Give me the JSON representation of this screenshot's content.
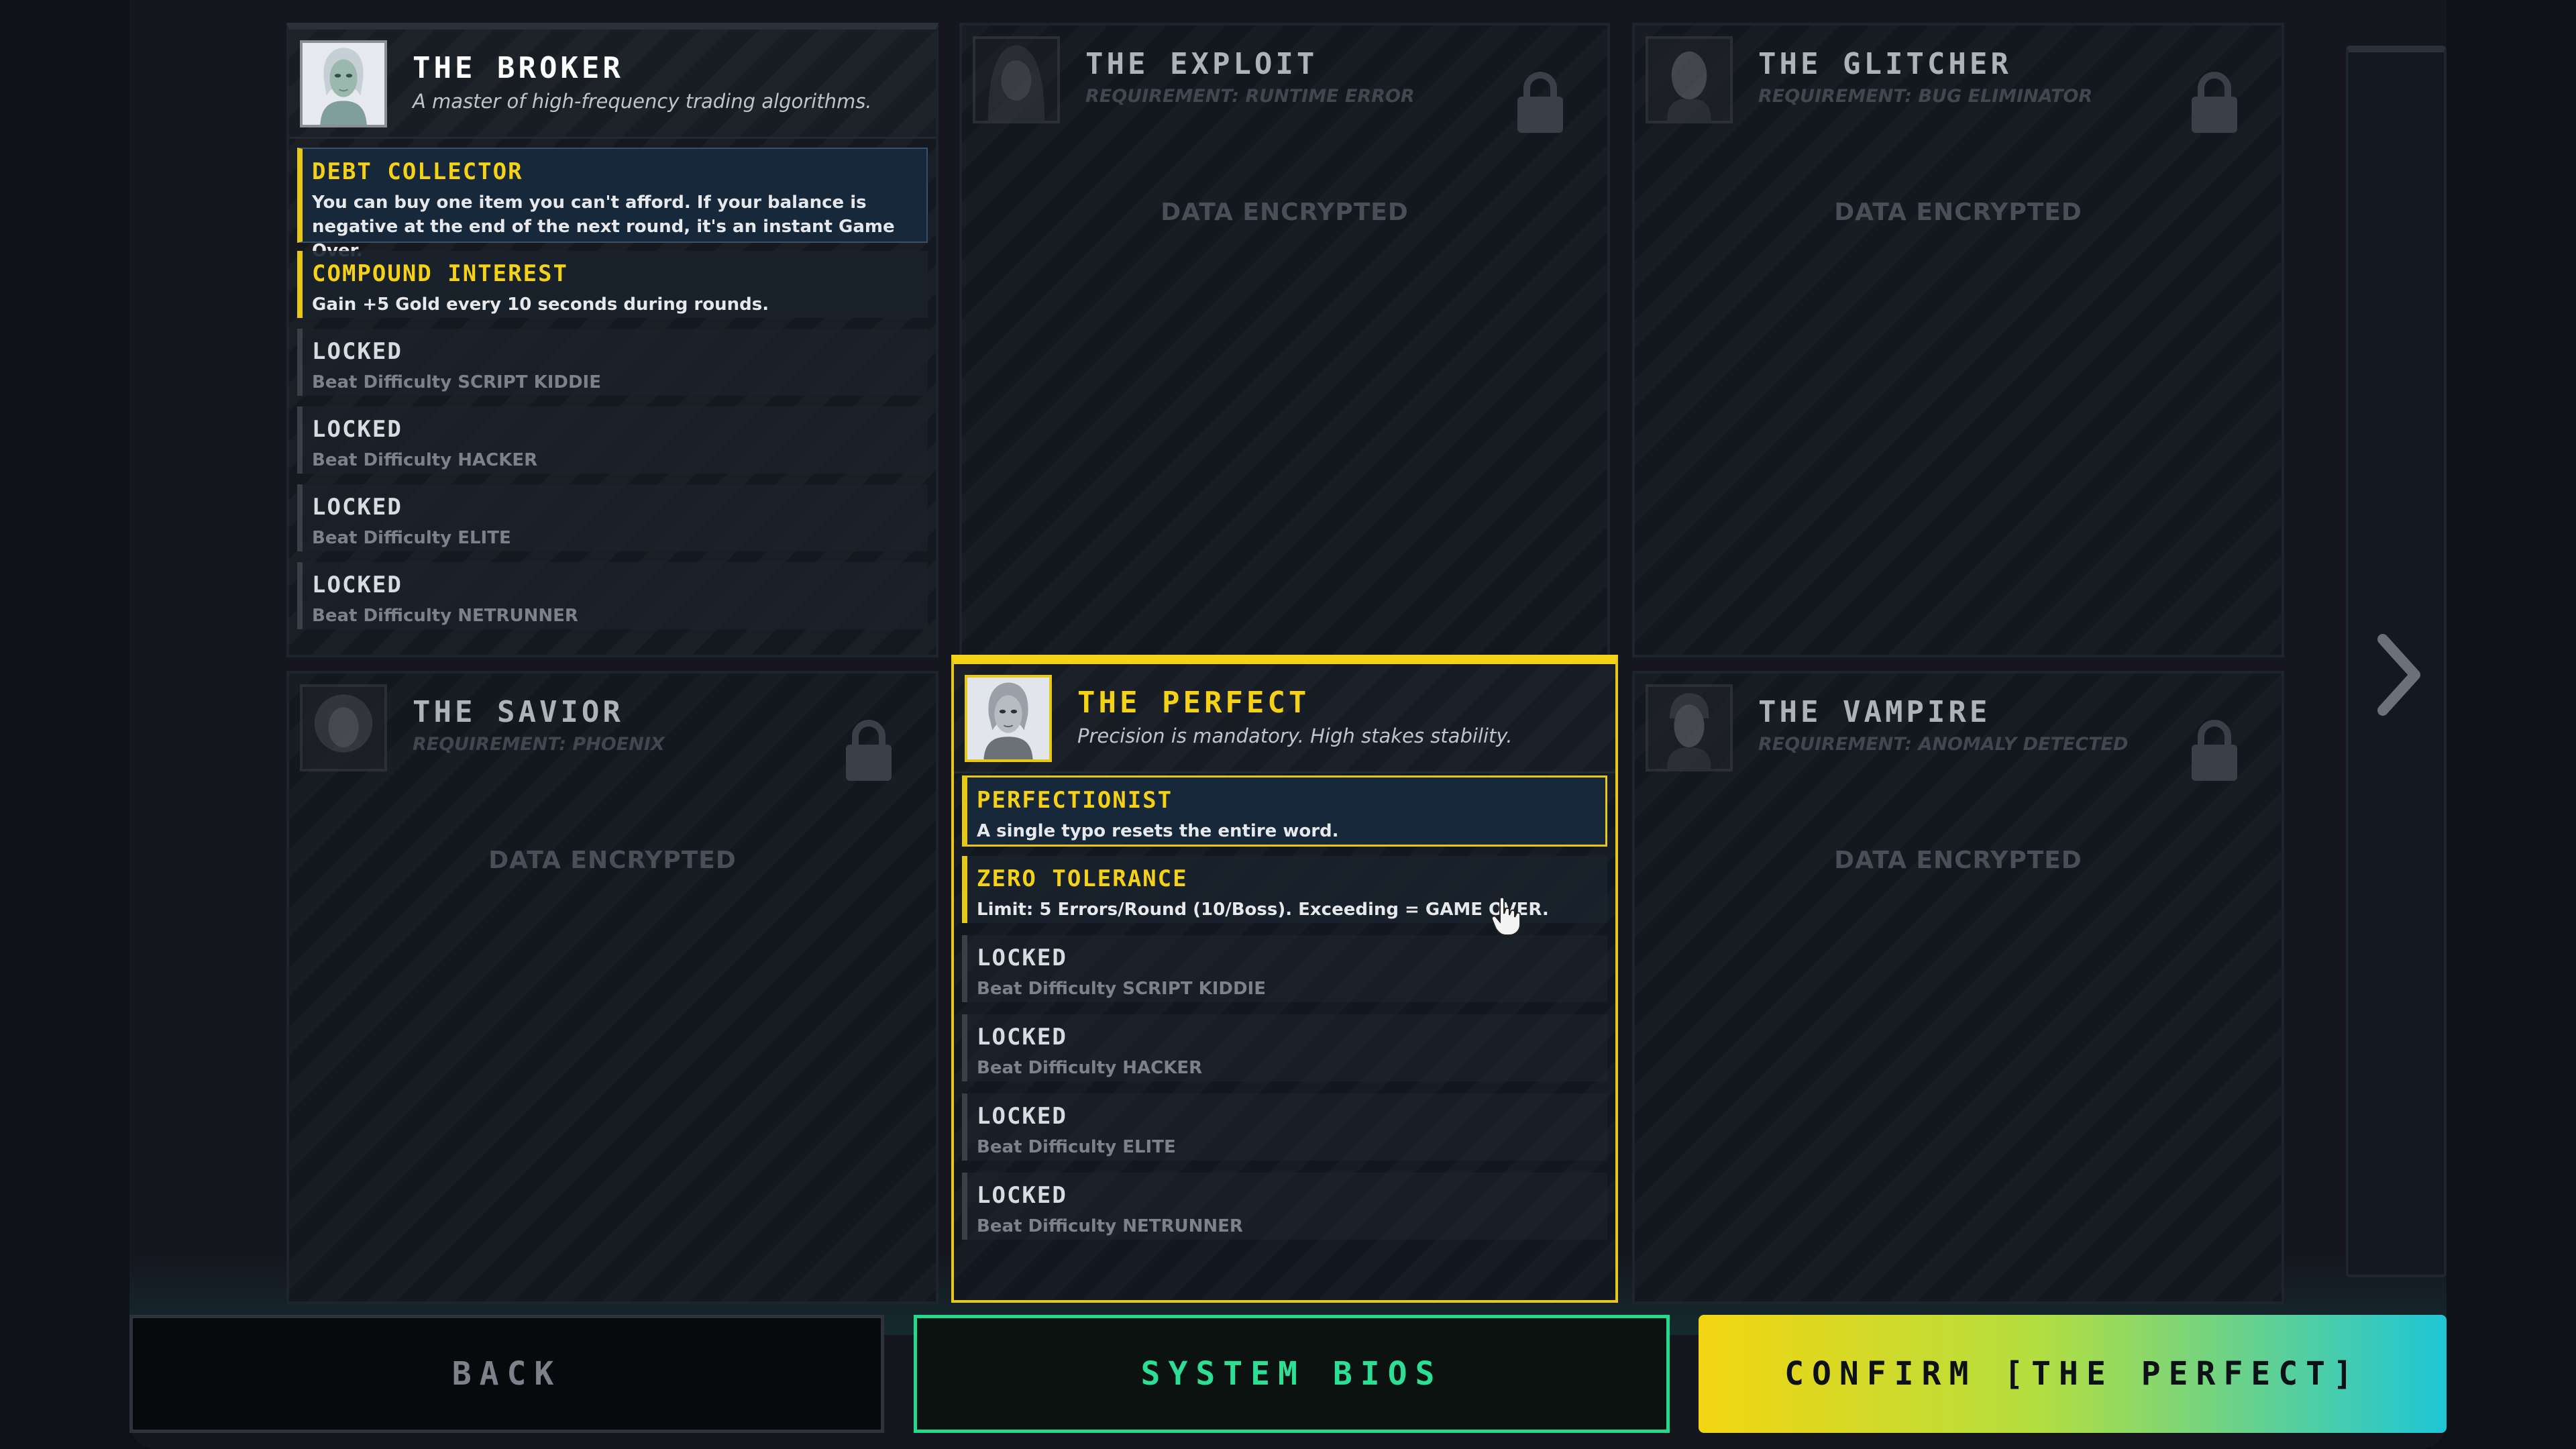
{
  "cards": [
    {
      "name": "THE BROKER",
      "subtitle": "A master of high-frequency trading algorithms.",
      "status": "unlocked",
      "portrait": "female-android-portrait",
      "perks": [
        {
          "title": "DEBT COLLECTOR",
          "desc": "You can buy one item you can't afford. If your balance is negative at the end of the next round, it's an instant Game Over.",
          "state": "active"
        },
        {
          "title": "COMPOUND INTEREST",
          "desc": "Gain +5 Gold every 10 seconds during rounds.",
          "state": "unlocked"
        },
        {
          "title": "LOCKED",
          "desc": "Beat Difficulty SCRIPT KIDDIE",
          "state": "locked"
        },
        {
          "title": "LOCKED",
          "desc": "Beat Difficulty HACKER",
          "state": "locked"
        },
        {
          "title": "LOCKED",
          "desc": "Beat Difficulty ELITE",
          "state": "locked"
        },
        {
          "title": "LOCKED",
          "desc": "Beat Difficulty NETRUNNER",
          "state": "locked"
        }
      ]
    },
    {
      "name": "THE EXPLOIT",
      "subtitle": "REQUIREMENT: RUNTIME ERROR",
      "status": "locked",
      "portrait": "hooded-figure-portrait",
      "encrypted": "DATA ENCRYPTED"
    },
    {
      "name": "THE GLITCHER",
      "subtitle": "REQUIREMENT: BUG ELIMINATOR",
      "status": "locked",
      "portrait": "bald-man-portrait",
      "encrypted": "DATA ENCRYPTED"
    },
    {
      "name": "THE SAVIOR",
      "subtitle": "REQUIREMENT: PHOENIX",
      "status": "locked",
      "portrait": "curly-hair-woman-portrait",
      "encrypted": "DATA ENCRYPTED"
    },
    {
      "name": "THE PERFECT",
      "subtitle": "Precision is mandatory. High stakes stability.",
      "status": "selected",
      "portrait": "silver-android-portrait",
      "perks": [
        {
          "title": "PERFECTIONIST",
          "desc": "A single typo resets the entire word.",
          "state": "active"
        },
        {
          "title": "ZERO TOLERANCE",
          "desc": "Limit: 5 Errors/Round (10/Boss). Exceeding = GAME OVER.",
          "state": "unlocked"
        },
        {
          "title": "LOCKED",
          "desc": "Beat Difficulty SCRIPT KIDDIE",
          "state": "locked"
        },
        {
          "title": "LOCKED",
          "desc": "Beat Difficulty HACKER",
          "state": "locked"
        },
        {
          "title": "LOCKED",
          "desc": "Beat Difficulty ELITE",
          "state": "locked"
        },
        {
          "title": "LOCKED",
          "desc": "Beat Difficulty NETRUNNER",
          "state": "locked"
        }
      ]
    },
    {
      "name": "THE VAMPIRE",
      "subtitle": "REQUIREMENT: ANOMALY DETECTED",
      "status": "locked",
      "portrait": "pale-man-portrait",
      "encrypted": "DATA ENCRYPTED"
    }
  ],
  "buttons": {
    "back": "BACK",
    "system_bios": "SYSTEM BIOS",
    "confirm": "CONFIRM [THE PERFECT]"
  },
  "icons": {
    "next": "chevron-right-icon",
    "lock": "lock-icon",
    "cursor": "hand-pointer-icon"
  },
  "colors": {
    "accent_gold": "#f5d216",
    "accent_green": "#2be095",
    "accent_cyan": "#1ec6d6",
    "background": "#15161e"
  }
}
